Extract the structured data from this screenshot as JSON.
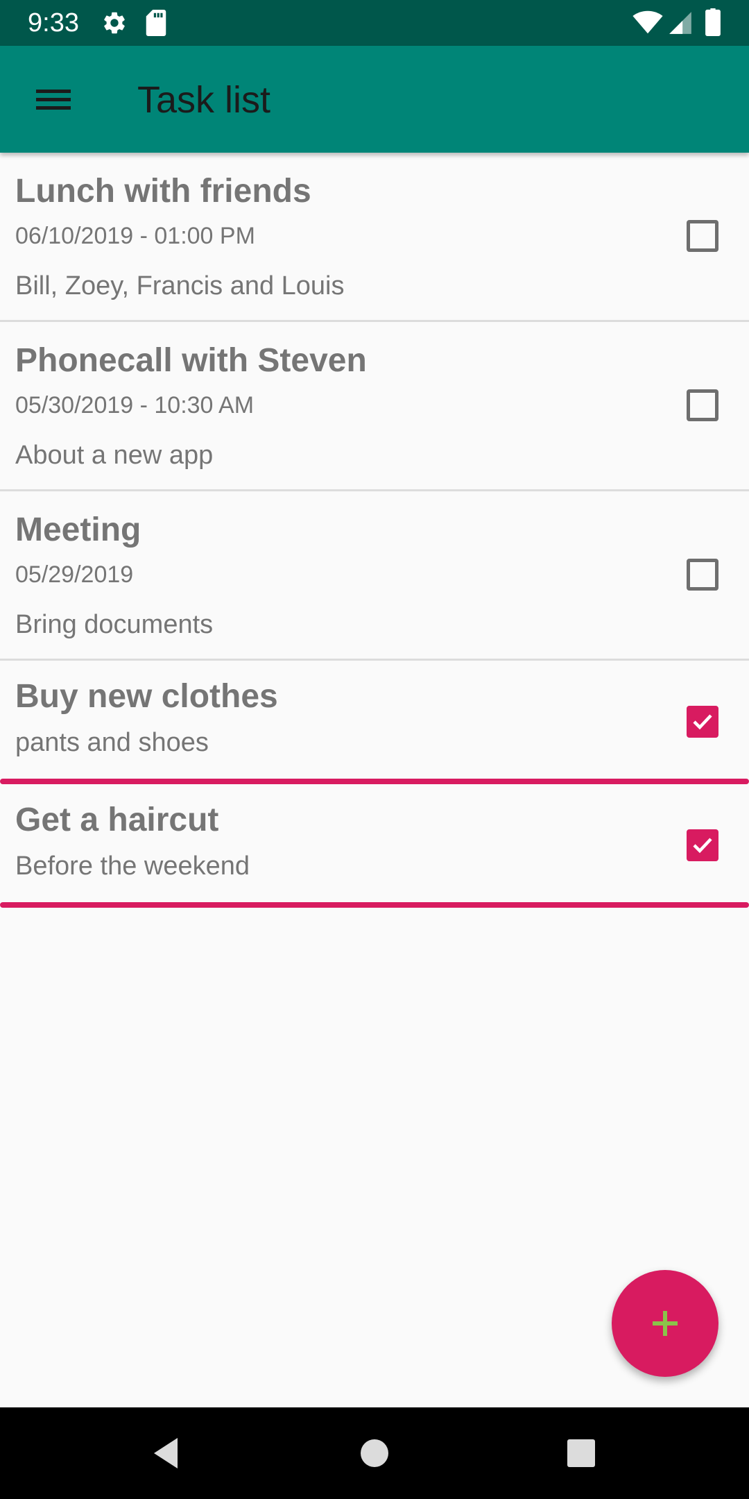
{
  "status_bar": {
    "time": "9:33",
    "icons": [
      "gear-icon",
      "sd-card-icon",
      "wifi-icon",
      "cell-signal-icon",
      "battery-icon"
    ]
  },
  "app_bar": {
    "title": "Task list",
    "menu_icon": "hamburger-menu-icon"
  },
  "tasks": [
    {
      "title": "Lunch with friends",
      "date": "06/10/2019 - 01:00 PM",
      "description": "Bill, Zoey, Francis and Louis",
      "checked": false
    },
    {
      "title": "Phonecall with Steven",
      "date": "05/30/2019 - 10:30 AM",
      "description": "About a new app",
      "checked": false
    },
    {
      "title": "Meeting",
      "date": "05/29/2019",
      "description": "Bring documents",
      "checked": false
    },
    {
      "title": "Buy new clothes",
      "description": "pants and shoes",
      "checked": true
    },
    {
      "title": "Get a haircut",
      "description": "Before the weekend",
      "checked": true
    }
  ],
  "fab": {
    "icon": "plus-icon"
  },
  "nav_bar": {
    "icons": [
      "back-icon",
      "home-icon",
      "recents-icon"
    ]
  },
  "colors": {
    "status_bar": "#00574b",
    "app_bar": "#008577",
    "accent": "#d81b60",
    "fab_plus": "#8bc34a",
    "text_gray": "#757575",
    "background": "#fafafa"
  }
}
